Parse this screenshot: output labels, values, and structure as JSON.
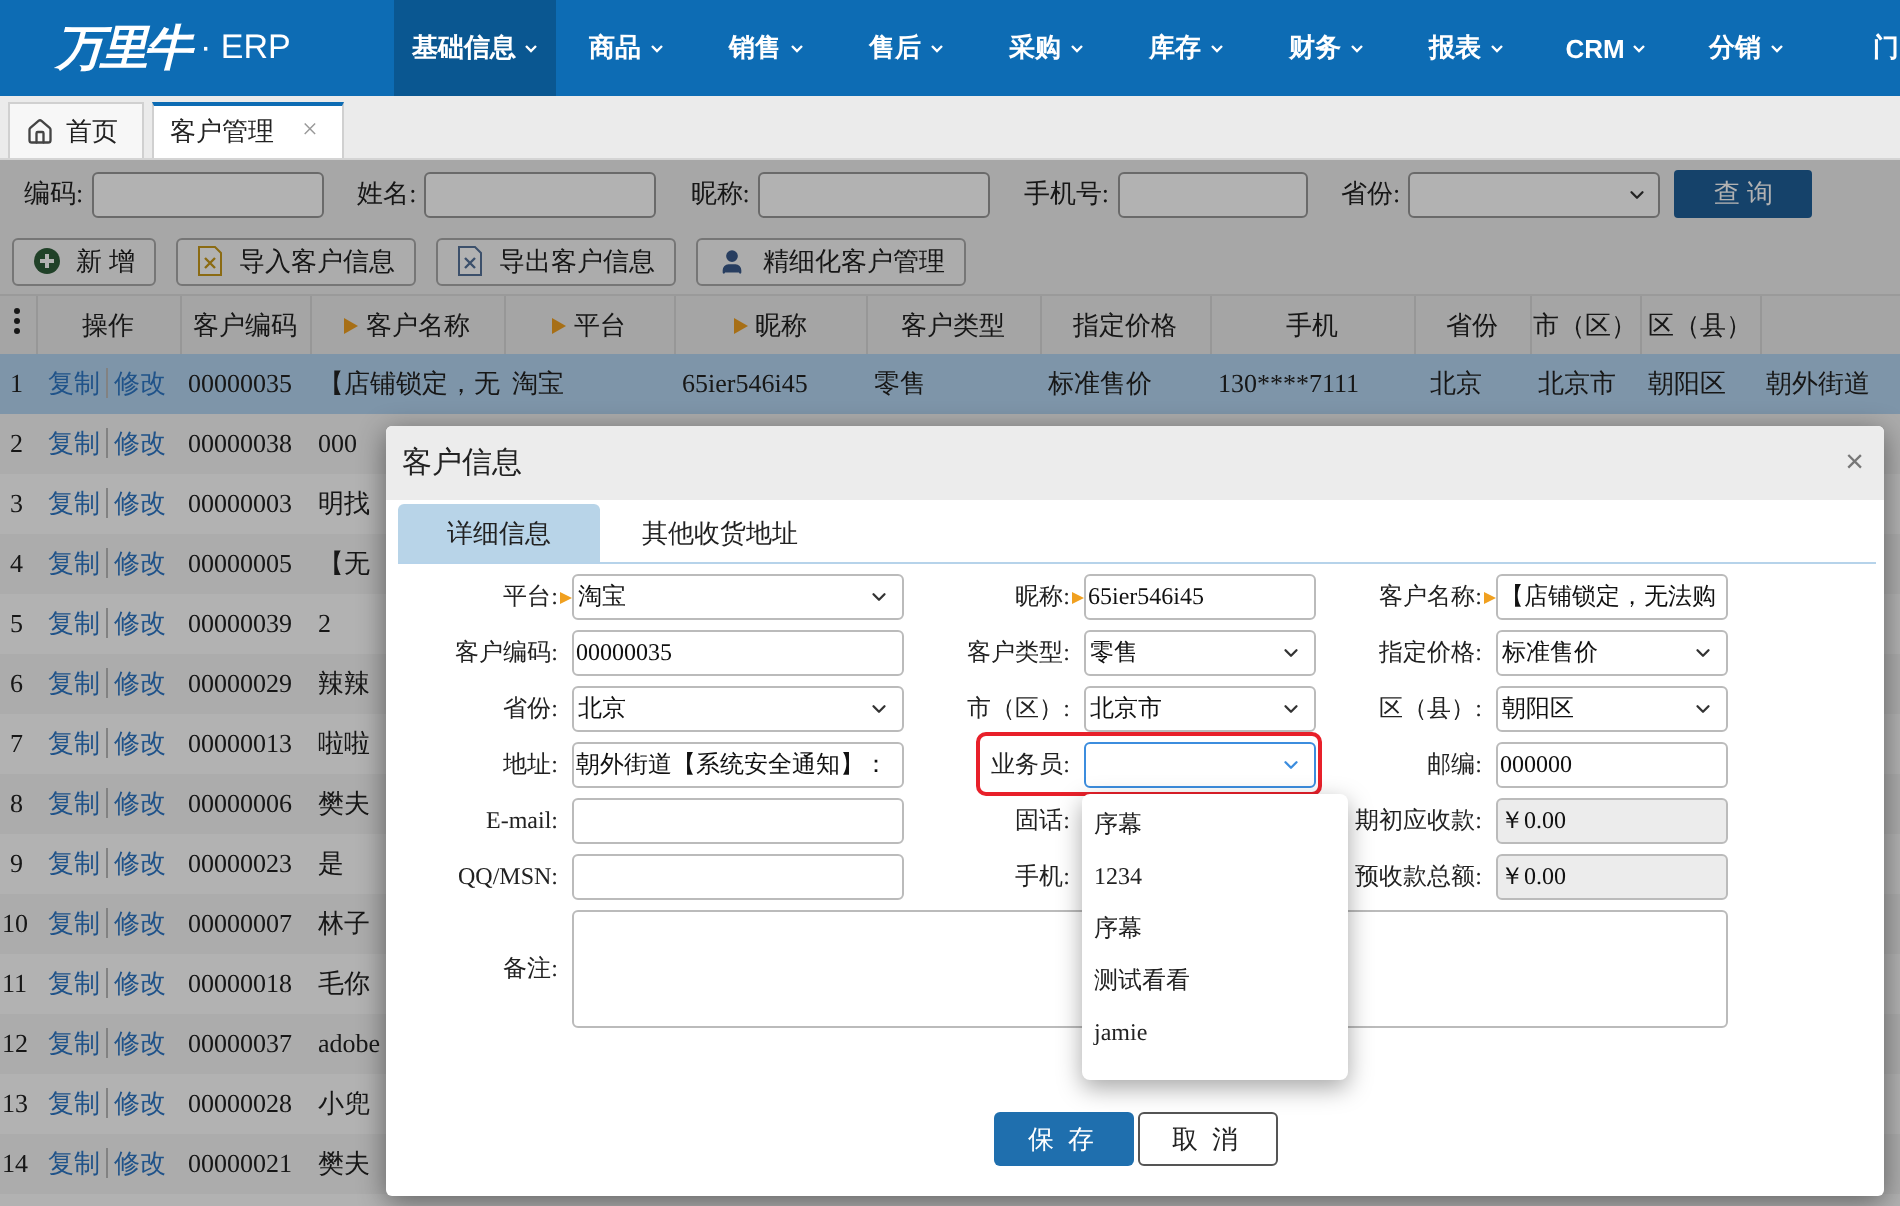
{
  "nav": {
    "logo": "万里牛",
    "product": "· ERP",
    "items": [
      {
        "label": "基础信息",
        "selected": true,
        "caret": true
      },
      {
        "label": "商品",
        "selected": false,
        "caret": true
      },
      {
        "label": "销售",
        "selected": false,
        "caret": true
      },
      {
        "label": "售后",
        "selected": false,
        "caret": true
      },
      {
        "label": "采购",
        "selected": false,
        "caret": true
      },
      {
        "label": "库存",
        "selected": false,
        "caret": true
      },
      {
        "label": "财务",
        "selected": false,
        "caret": true
      },
      {
        "label": "报表",
        "selected": false,
        "caret": true
      },
      {
        "label": "CRM",
        "selected": false,
        "caret": true
      },
      {
        "label": "分销",
        "selected": false,
        "caret": true
      },
      {
        "label": "门",
        "selected": false,
        "caret": false
      }
    ]
  },
  "page_tabs": [
    {
      "label": "首页",
      "kind": "home",
      "selected": false
    },
    {
      "label": "客户管理",
      "close": "×",
      "selected": true
    }
  ],
  "search": {
    "fields": [
      {
        "label": "编码:",
        "kind": "text"
      },
      {
        "label": "姓名:",
        "kind": "text"
      },
      {
        "label": "昵称:",
        "kind": "text"
      },
      {
        "label": "手机号:",
        "kind": "text"
      },
      {
        "label": "省份:",
        "kind": "select"
      }
    ],
    "button": "查 询"
  },
  "toolbar": [
    {
      "label": "新 增",
      "kind": "add"
    },
    {
      "label": "导入客户信息",
      "kind": "import"
    },
    {
      "label": "导出客户信息",
      "kind": "export"
    },
    {
      "label": "精细化客户管理",
      "kind": "user"
    }
  ],
  "table": {
    "columns": [
      {
        "label": "操作",
        "sortable": false
      },
      {
        "label": "客户编码",
        "sortable": false
      },
      {
        "label": "客户名称",
        "sortable": true
      },
      {
        "label": "平台",
        "sortable": true
      },
      {
        "label": "昵称",
        "sortable": true
      },
      {
        "label": "客户类型",
        "sortable": false
      },
      {
        "label": "指定价格",
        "sortable": false
      },
      {
        "label": "手机",
        "sortable": false
      },
      {
        "label": "省份",
        "sortable": false
      },
      {
        "label": "市（区）",
        "sortable": false
      },
      {
        "label": "区（县）",
        "sortable": false
      }
    ],
    "rows": [
      {
        "index": "1",
        "selected": true,
        "actions": [
          "复制",
          "修改"
        ],
        "code": "00000035",
        "name": "【店铺锁定，无",
        "platform": "淘宝",
        "nickname": "65ier546i45",
        "customer_type": "零售",
        "price": "标准售价",
        "phone": "130****7111",
        "province": "北京",
        "city": "北京市",
        "district": "朝阳区",
        "column_13": "朝外街道"
      },
      {
        "index": "2",
        "selected": false,
        "actions": [
          "复制",
          "修改"
        ],
        "code": "00000038",
        "name": "000"
      },
      {
        "index": "3",
        "selected": false,
        "actions": [
          "复制",
          "修改"
        ],
        "code": "00000003",
        "name": "明找"
      },
      {
        "index": "4",
        "selected": false,
        "actions": [
          "复制",
          "修改"
        ],
        "code": "00000005",
        "name": "【无"
      },
      {
        "index": "5",
        "selected": false,
        "actions": [
          "复制",
          "修改"
        ],
        "code": "00000039",
        "name": "2"
      },
      {
        "index": "6",
        "selected": false,
        "actions": [
          "复制",
          "修改"
        ],
        "code": "00000029",
        "name": "辣辣"
      },
      {
        "index": "7",
        "selected": false,
        "actions": [
          "复制",
          "修改"
        ],
        "code": "00000013",
        "name": "啦啦"
      },
      {
        "index": "8",
        "selected": false,
        "actions": [
          "复制",
          "修改"
        ],
        "code": "00000006",
        "name": "樊夫"
      },
      {
        "index": "9",
        "selected": false,
        "actions": [
          "复制",
          "修改"
        ],
        "code": "00000023",
        "name": "是"
      },
      {
        "index": "10",
        "selected": false,
        "actions": [
          "复制",
          "修改"
        ],
        "code": "00000007",
        "name": "林子"
      },
      {
        "index": "11",
        "selected": false,
        "actions": [
          "复制",
          "修改"
        ],
        "code": "00000018",
        "name": "毛你"
      },
      {
        "index": "12",
        "selected": false,
        "actions": [
          "复制",
          "修改"
        ],
        "code": "00000037",
        "name": "adobe"
      },
      {
        "index": "13",
        "selected": false,
        "actions": [
          "复制",
          "修改"
        ],
        "code": "00000028",
        "name": "小兜"
      },
      {
        "index": "14",
        "selected": false,
        "actions": [
          "复制",
          "修改"
        ],
        "code": "00000021",
        "name": "樊夫"
      }
    ]
  },
  "modal": {
    "title": "客户信息",
    "close": "×",
    "tabs": [
      {
        "label": "详细信息",
        "selected": true
      },
      {
        "label": "其他收货地址",
        "selected": false
      }
    ],
    "form": {
      "rows": [
        {
          "fields": [
            {
              "label": "平台:",
              "kind": "select",
              "value": "淘宝",
              "required": true,
              "focused": false,
              "highlighted": false
            },
            {
              "label": "昵称:",
              "kind": "text",
              "value": "65ier546i45",
              "required": true,
              "focused": false,
              "highlighted": false
            },
            {
              "label": "客户名称:",
              "kind": "text",
              "value": "【店铺锁定，无法购",
              "required": true,
              "focused": false,
              "highlighted": false
            }
          ]
        },
        {
          "fields": [
            {
              "label": "客户编码:",
              "kind": "text",
              "value": "00000035",
              "required": false,
              "focused": false,
              "highlighted": false
            },
            {
              "label": "客户类型:",
              "kind": "select",
              "value": "零售",
              "required": false,
              "focused": false,
              "highlighted": false
            },
            {
              "label": "指定价格:",
              "kind": "select",
              "value": "标准售价",
              "required": false,
              "focused": false,
              "highlighted": false
            }
          ]
        },
        {
          "fields": [
            {
              "label": "省份:",
              "kind": "select",
              "value": "北京",
              "required": false,
              "focused": false,
              "highlighted": false
            },
            {
              "label": "市（区）:",
              "kind": "select",
              "value": "北京市",
              "required": false,
              "focused": false,
              "highlighted": false
            },
            {
              "label": "区（县）:",
              "kind": "select",
              "value": "朝阳区",
              "required": false,
              "focused": false,
              "highlighted": false
            }
          ]
        },
        {
          "fields": [
            {
              "label": "地址:",
              "kind": "text",
              "value": "朝外街道【系统安全通知】：",
              "required": false,
              "focused": false,
              "highlighted": false
            },
            {
              "label": "业务员:",
              "kind": "select",
              "required": false,
              "focused": true,
              "highlighted": true
            },
            {
              "label": "邮编:",
              "kind": "text",
              "value": "000000",
              "required": false,
              "focused": false,
              "highlighted": false
            }
          ]
        },
        {
          "fields": [
            {
              "label": "E-mail:",
              "kind": "text",
              "required": false,
              "focused": false,
              "highlighted": false
            },
            {
              "label": "固话:",
              "kind": "covered",
              "required": false
            },
            {
              "label": "期初应收款:",
              "kind": "readonly",
              "value": "￥0.00",
              "required": false,
              "focused": false,
              "highlighted": false
            }
          ]
        },
        {
          "fields": [
            {
              "label": "QQ/MSN:",
              "kind": "text",
              "required": false,
              "focused": false,
              "highlighted": false
            },
            {
              "label": "手机:",
              "kind": "covered",
              "required": false
            },
            {
              "label": "预收款总额:",
              "kind": "readonly",
              "value": "￥0.00",
              "required": false,
              "focused": false,
              "highlighted": false
            }
          ]
        }
      ],
      "remark": {
        "label": "备注:"
      }
    },
    "buttons": [
      {
        "label": "保 存",
        "kind": "primary"
      },
      {
        "label": "取 消",
        "kind": "secondary"
      }
    ],
    "dropdown": {
      "options": [
        "序幕",
        "1234",
        "序幕",
        "测试看看",
        "jamie"
      ]
    }
  }
}
